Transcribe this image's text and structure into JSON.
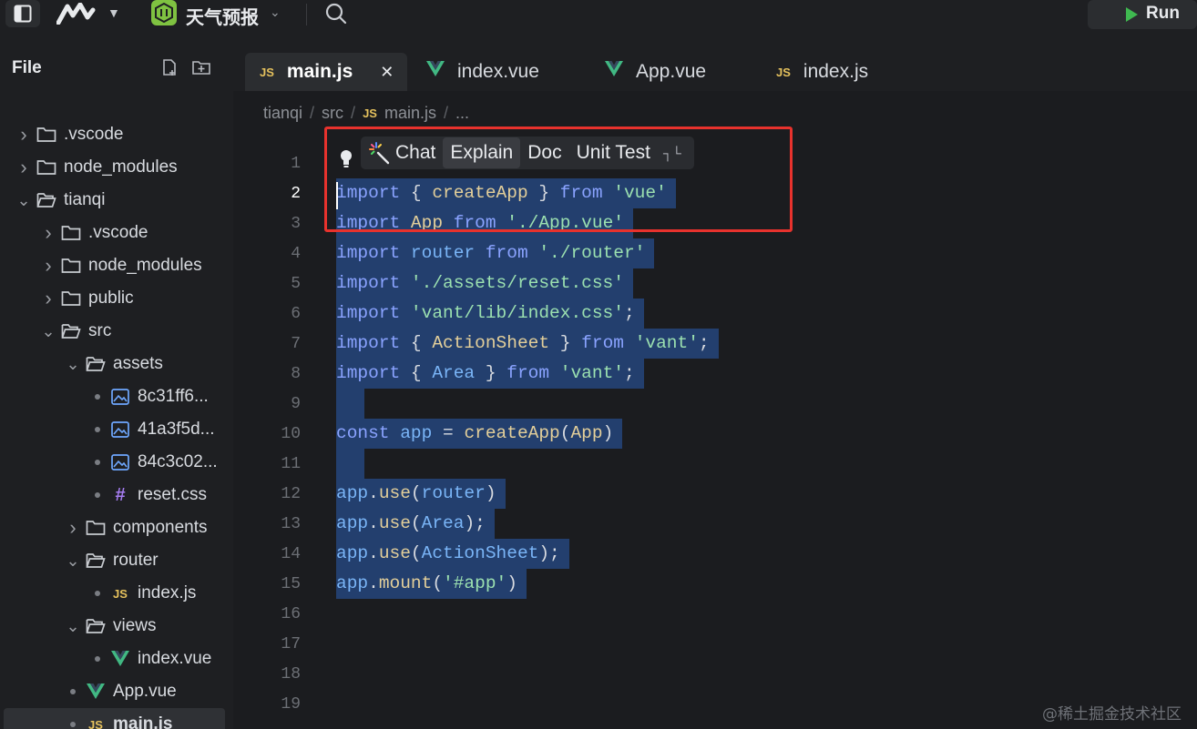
{
  "topbar": {
    "project_name": "天气预报",
    "run_label": "Run"
  },
  "sidebar": {
    "header": "File",
    "items": [
      {
        "label": ".vscode",
        "type": "folder",
        "expanded": false
      },
      {
        "label": "node_modules",
        "type": "folder",
        "expanded": false
      },
      {
        "label": "tianqi",
        "type": "folder",
        "expanded": true
      },
      {
        "label": ".vscode",
        "type": "folder",
        "expanded": false
      },
      {
        "label": "node_modules",
        "type": "folder",
        "expanded": false
      },
      {
        "label": "public",
        "type": "folder",
        "expanded": false
      },
      {
        "label": "src",
        "type": "folder",
        "expanded": true
      },
      {
        "label": "assets",
        "type": "folder",
        "expanded": true
      },
      {
        "label": "8c31ff6...",
        "type": "image"
      },
      {
        "label": "41a3f5d...",
        "type": "image"
      },
      {
        "label": "84c3c02...",
        "type": "image"
      },
      {
        "label": "reset.css",
        "type": "css"
      },
      {
        "label": "components",
        "type": "folder",
        "expanded": false
      },
      {
        "label": "router",
        "type": "folder",
        "expanded": true
      },
      {
        "label": "index.js",
        "type": "js"
      },
      {
        "label": "views",
        "type": "folder",
        "expanded": true
      },
      {
        "label": "index.vue",
        "type": "vue"
      },
      {
        "label": "App.vue",
        "type": "vue"
      },
      {
        "label": "main.js",
        "type": "js",
        "selected": true
      }
    ]
  },
  "tabs": [
    {
      "label": "main.js",
      "type": "js",
      "active": true
    },
    {
      "label": "index.vue",
      "type": "vue"
    },
    {
      "label": "App.vue",
      "type": "vue"
    },
    {
      "label": "index.js",
      "type": "js"
    }
  ],
  "breadcrumb": {
    "parts": [
      "tianqi",
      "src",
      "main.js",
      "..."
    ],
    "js_badge": "JS"
  },
  "ai_actions": {
    "items": [
      "Chat",
      "Explain",
      "Doc",
      "Unit Test"
    ],
    "collapse_glyph": "┐└"
  },
  "editor": {
    "current_line": "2",
    "line_numbers": [
      "1",
      "2",
      "3",
      "4",
      "5",
      "6",
      "7",
      "8",
      "9",
      "10",
      "11",
      "12",
      "13",
      "14",
      "15",
      "16",
      "17",
      "18",
      "19"
    ],
    "code": [
      "",
      "import { createApp } from 'vue'",
      "import App from './App.vue'",
      "import router from './router'",
      "import './assets/reset.css'",
      "import 'vant/lib/index.css';",
      "import { ActionSheet } from 'vant';",
      "import { Area } from 'vant';",
      "",
      "const app = createApp(App)",
      "",
      "app.use(router)",
      "app.use(Area);",
      "app.use(ActionSheet);",
      "app.mount('#app')"
    ]
  },
  "watermark": "@稀土掘金技术社区",
  "colors": {
    "accent_selection": "#233f6e",
    "highlight_box": "#e8322d",
    "run_green": "#3fb950",
    "vue_green": "#41b883",
    "js_yellow": "#e5c15d"
  }
}
